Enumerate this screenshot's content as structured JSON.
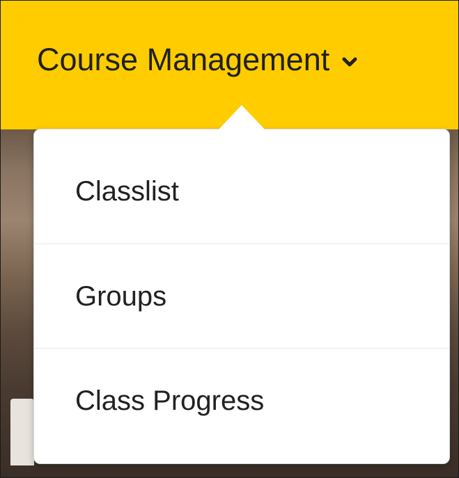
{
  "navbar": {
    "menu_label": "Course Management",
    "chevron_icon": "chevron-down-icon",
    "background_color": "#ffcc00"
  },
  "dropdown": {
    "items": [
      {
        "label": "Classlist"
      },
      {
        "label": "Groups"
      },
      {
        "label": "Class Progress"
      }
    ]
  },
  "colors": {
    "text": "#202122",
    "divider": "#e3e9f1",
    "menu_background": "#ffffff"
  }
}
